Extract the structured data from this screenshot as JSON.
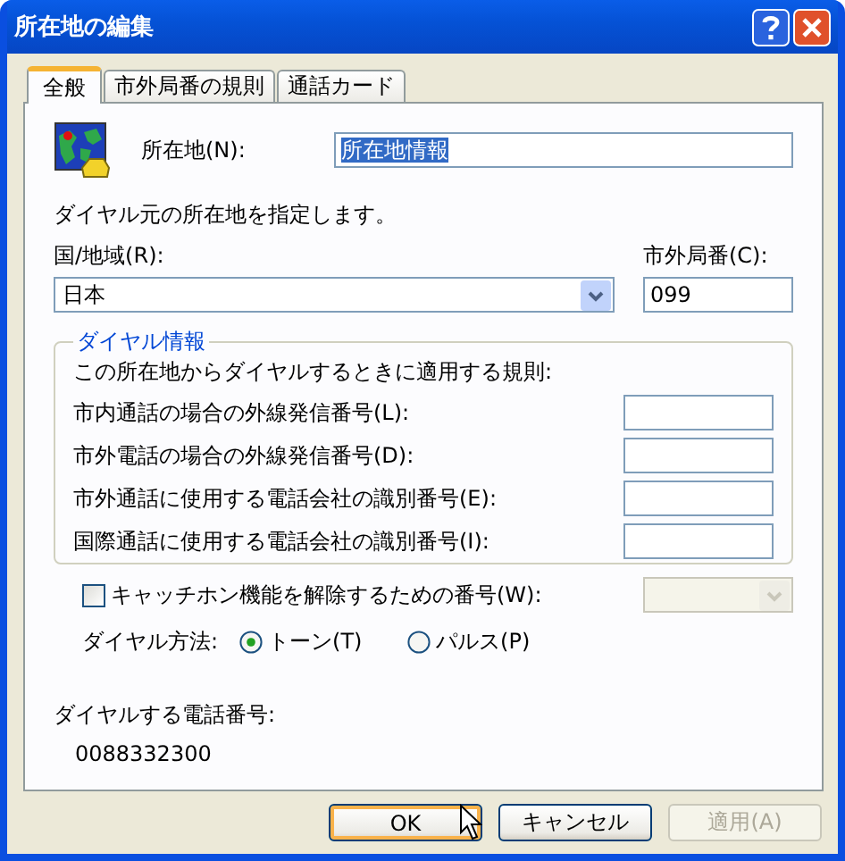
{
  "window": {
    "title": "所在地の編集"
  },
  "tabs": [
    {
      "label": "全般",
      "selected": true
    },
    {
      "label": "市外局番の規則",
      "selected": false
    },
    {
      "label": "通話カード",
      "selected": false
    }
  ],
  "location": {
    "label": "所在地(N):",
    "value": "所在地情報",
    "text_selected": true
  },
  "instruction": "ダイヤル元の所在地を指定します。",
  "country": {
    "label": "国/地域(R):",
    "value": "日本"
  },
  "area_code": {
    "label": "市外局番(C):",
    "value": "099"
  },
  "dialing_rules": {
    "title": "ダイヤル情報",
    "intro": "この所在地からダイヤルするときに適用する規則:",
    "fields": [
      {
        "label": "市内通話の場合の外線発信番号(L):"
      },
      {
        "label": "市外電話の場合の外線発信番号(D):"
      },
      {
        "label": "市外通話に使用する電話会社の識別番号(E):"
      },
      {
        "label": "国際通話に使用する電話会社の識別番号(I):"
      }
    ]
  },
  "call_waiting": {
    "label": "キャッチホン機能を解除するための番号(W):",
    "checked": false,
    "combo_disabled": true
  },
  "dial_method": {
    "label": "ダイヤル方法:",
    "options": [
      {
        "label": "トーン(T)",
        "selected": true
      },
      {
        "label": "パルス(P)",
        "selected": false
      }
    ]
  },
  "number_to_dial": {
    "label": "ダイヤルする電話番号:",
    "value": "0088332300"
  },
  "buttons": [
    {
      "label": "OK",
      "default": true,
      "disabled": false
    },
    {
      "label": "キャンセル",
      "default": false,
      "disabled": false
    },
    {
      "label": "適用(A)",
      "default": false,
      "disabled": true
    }
  ]
}
